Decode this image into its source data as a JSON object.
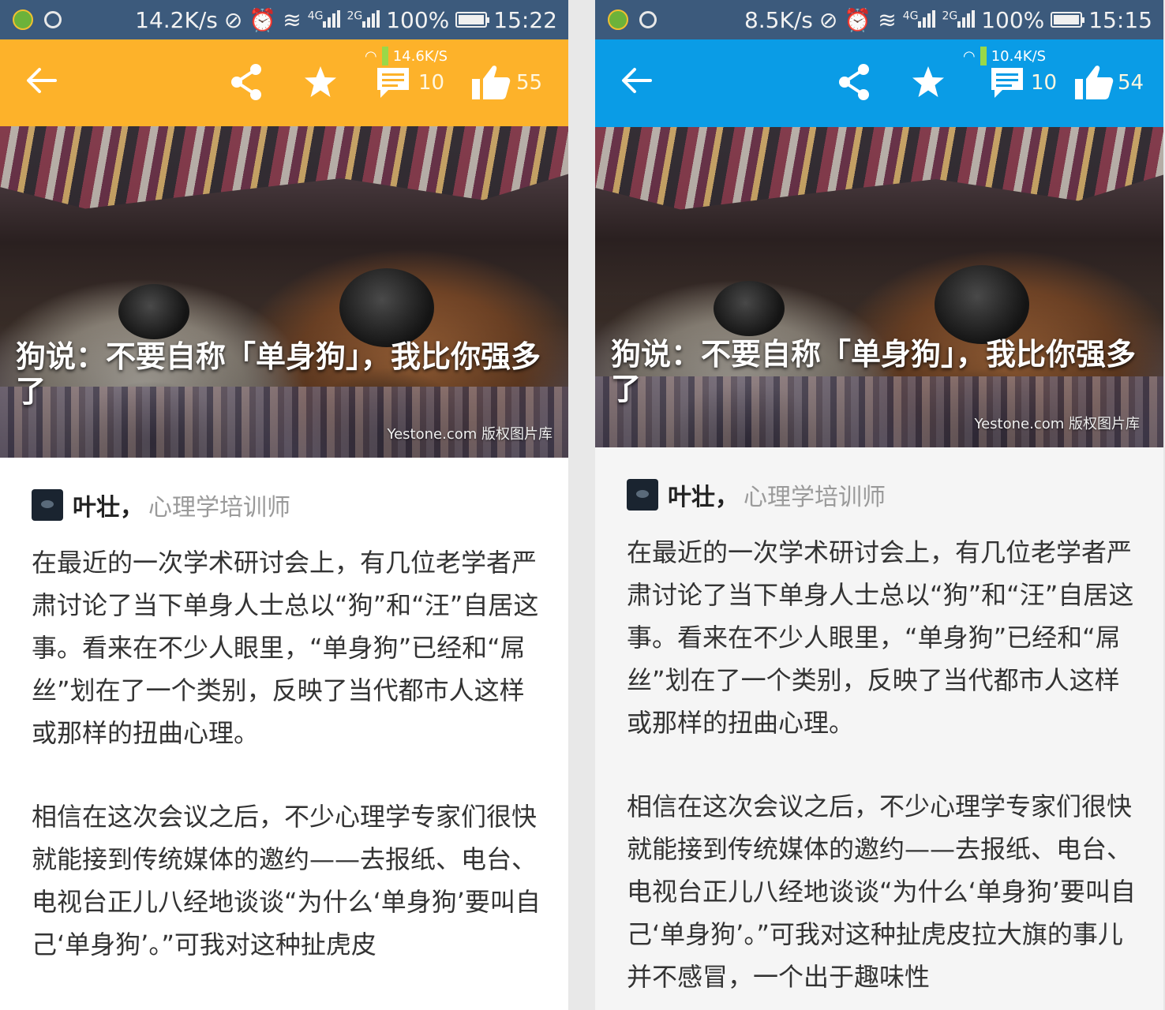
{
  "phones": [
    {
      "status": {
        "net_speed": "14.2K/s",
        "net4g": "4G",
        "net2g": "2G",
        "battery": "100%",
        "battery_level": 1.0,
        "time": "15:22"
      },
      "toolbar": {
        "accent": "#fdb22a",
        "overlay_speed": "14.6K/S",
        "comment_count": "10",
        "like_count": "55"
      },
      "hero": {
        "title": "狗说：不要自称「单身狗」，我比你强多了",
        "credit": "Yestone.com 版权图片库"
      },
      "author": {
        "name": "叶壮，",
        "title": "心理学培训师"
      },
      "paragraphs": [
        "在最近的一次学术研讨会上，有几位老学者严肃讨论了当下单身人士总以“狗”和“汪”自居这事。看来在不少人眼里，“单身狗”已经和“屌丝”划在了一个类别，反映了当代都市人这样或那样的扭曲心理。",
        "相信在这次会议之后，不少心理学专家们很快就能接到传统媒体的邀约——去报纸、电台、电视台正儿八经地谈谈“为什么‘单身狗’要叫自己‘单身狗’。”可我对这种扯虎皮"
      ]
    },
    {
      "status": {
        "net_speed": "8.5K/s",
        "net4g": "4G",
        "net2g": "2G",
        "battery": "100%",
        "battery_level": 1.0,
        "time": "15:15"
      },
      "toolbar": {
        "accent": "#0a9ce6",
        "overlay_speed": "10.4K/S",
        "comment_count": "10",
        "like_count": "54"
      },
      "hero": {
        "title": "狗说：不要自称「单身狗」，我比你强多了",
        "credit": "Yestone.com 版权图片库"
      },
      "author": {
        "name": "叶壮，",
        "title": "心理学培训师"
      },
      "paragraphs": [
        "在最近的一次学术研讨会上，有几位老学者严肃讨论了当下单身人士总以“狗”和“汪”自居这事。看来在不少人眼里，“单身狗”已经和“屌丝”划在了一个类别，反映了当代都市人这样或那样的扭曲心理。",
        "相信在这次会议之后，不少心理学专家们很快就能接到传统媒体的邀约——去报纸、电台、电视台正儿八经地谈谈“为什么‘单身狗’要叫自己‘单身狗’。”可我对这种扯虎皮拉大旗的事儿并不感冒，一个出于趣味性"
      ]
    }
  ]
}
